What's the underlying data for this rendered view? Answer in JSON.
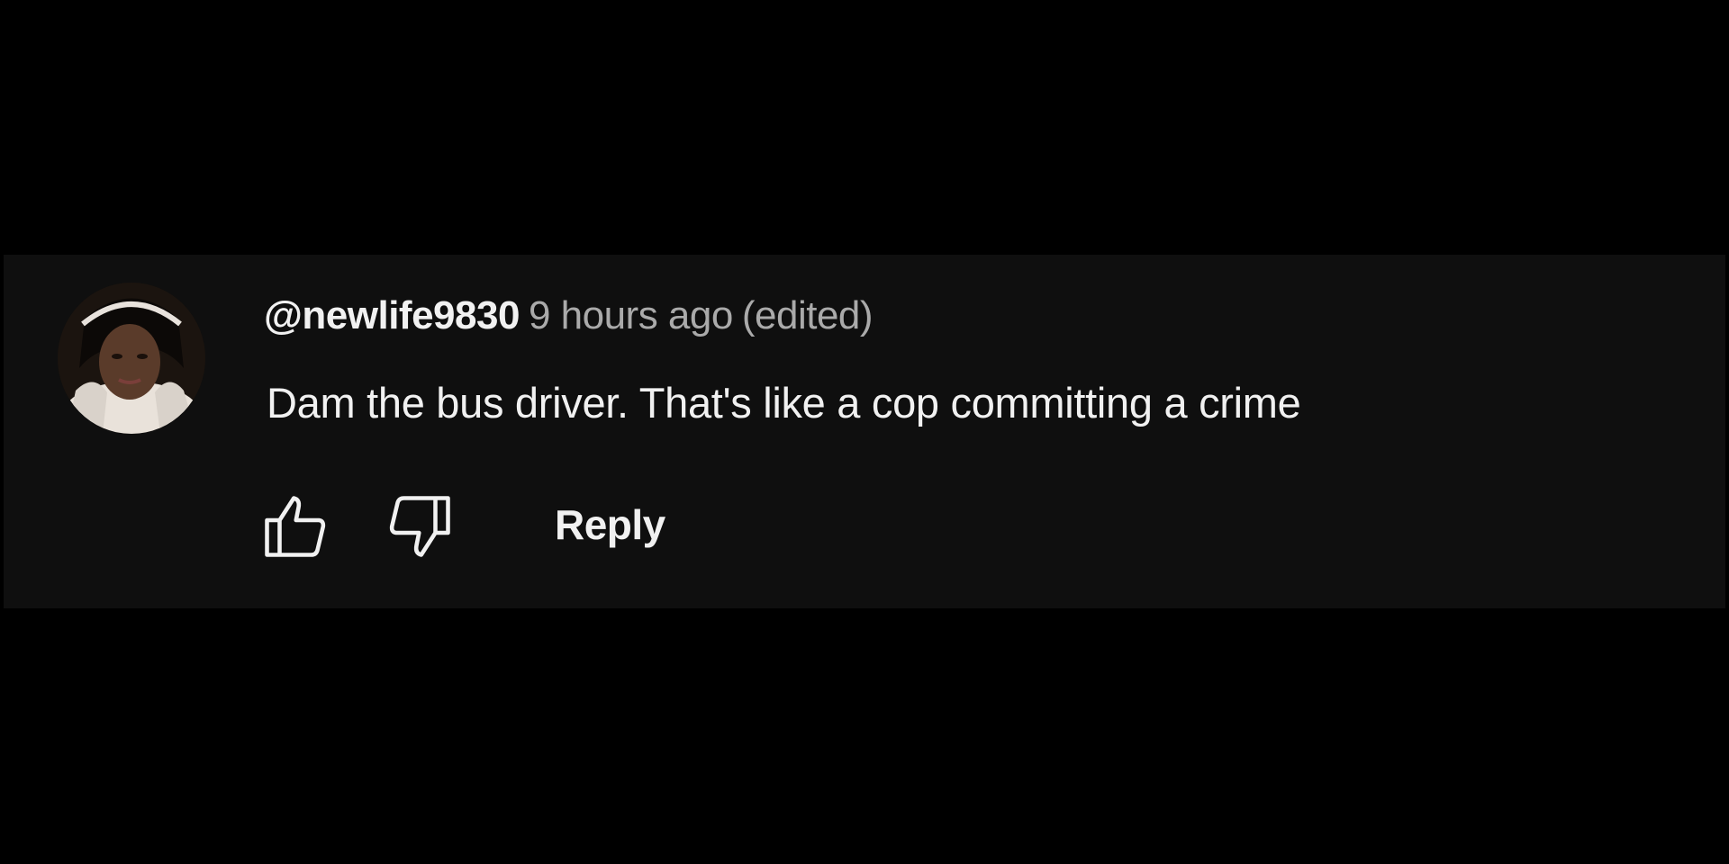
{
  "comment": {
    "author": "@newlife9830",
    "timestamp": "9 hours ago",
    "edited_label": "(edited)",
    "text": "Dam the bus driver. That's like a cop committing a crime",
    "avatar_icon": "user-avatar",
    "actions": {
      "like_icon": "thumbs-up-icon",
      "dislike_icon": "thumbs-down-icon",
      "reply_label": "Reply"
    }
  },
  "colors": {
    "page_background": "#000000",
    "card_background": "#0f0f0f",
    "primary_text": "#f1f1f1",
    "secondary_text": "#aaaaaa"
  }
}
